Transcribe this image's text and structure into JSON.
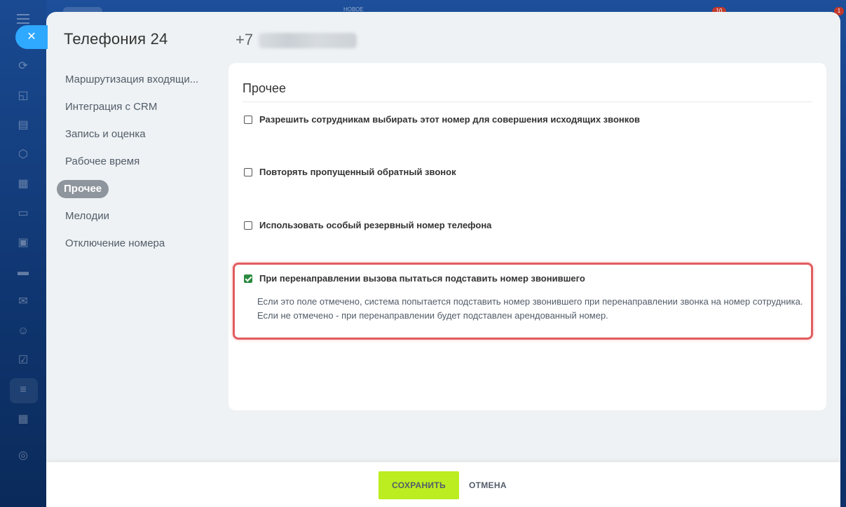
{
  "top": {
    "new_label": "НОВОЕ",
    "badge_left": "10",
    "badge_right": "1"
  },
  "panel": {
    "title": "Телефония 24",
    "phone_prefix": "+7"
  },
  "nav": {
    "items": [
      "Маршрутизация входящи...",
      "Интеграция с CRM",
      "Запись и оценка",
      "Рабочее время",
      "Прочее",
      "Мелодии",
      "Отключение номера"
    ],
    "active_index": 4
  },
  "card": {
    "title": "Прочее",
    "options": [
      {
        "label": "Разрешить сотрудникам выбирать этот номер для совершения исходящих звонков",
        "checked": false
      },
      {
        "label": "Повторять пропущенный обратный звонок",
        "checked": false
      },
      {
        "label": "Использовать особый резервный номер телефона",
        "checked": false
      },
      {
        "label": "При перенаправлении вызова пытаться подставить номер звонившего",
        "checked": true
      }
    ],
    "description": "Если это поле отмечено, система попытается подставить номер звонившего при перенаправлении звонка на номер сотрудника. Если не отмечено - при перенаправлении будет подставлен арендованный номер."
  },
  "footer": {
    "save_label": "СОХРАНИТЬ",
    "cancel_label": "ОТМЕНА"
  },
  "colors": {
    "accent_save": "#bbed21",
    "checkbox_checked": "#2a8a3e",
    "highlight": "#e25c5f",
    "close_button": "#2fa8ff"
  },
  "icons": [
    "menu-icon",
    "close-icon",
    "crm-icon",
    "chat-icon",
    "tasks-icon",
    "hexagon-icon",
    "calendar-icon",
    "document-icon",
    "projects-icon",
    "card-icon",
    "mail-icon",
    "contacts-icon",
    "checkbox-icon",
    "filter-icon",
    "grid-icon",
    "settings-icon"
  ]
}
